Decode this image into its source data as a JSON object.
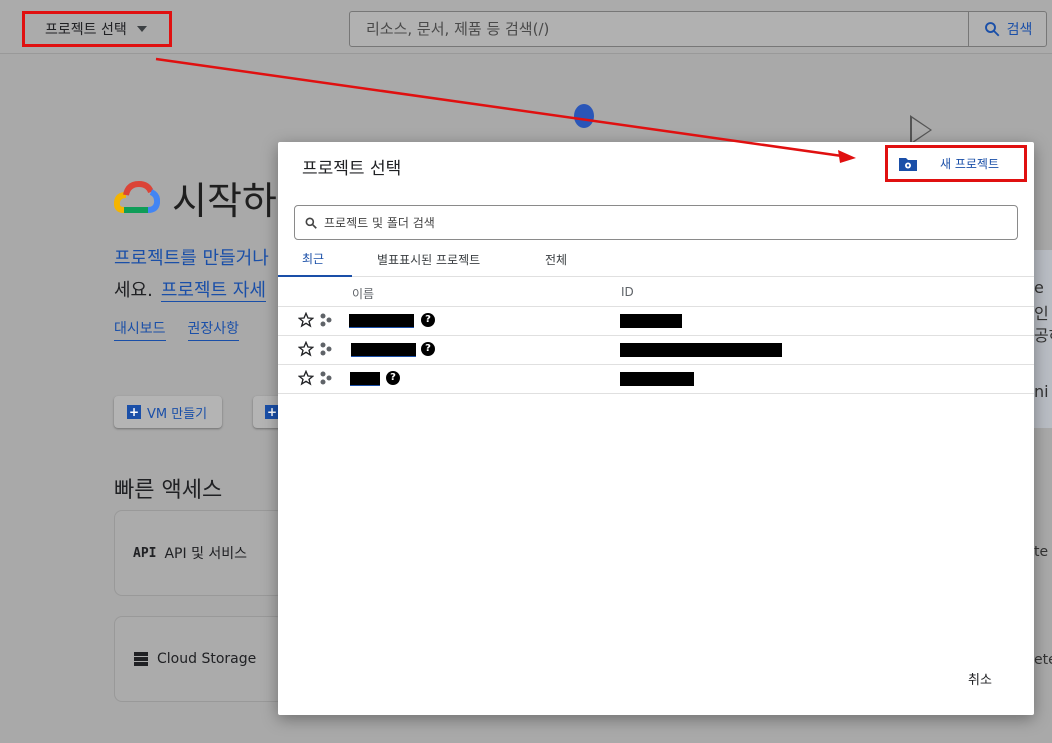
{
  "topbar": {
    "project_picker_label": "프로젝트 선택",
    "search_placeholder": "리소스, 문서, 제품 등 검색(/)",
    "search_button_label": "검색"
  },
  "background": {
    "title": "시작하",
    "intro_link": "프로젝트를 만들거나",
    "intro_text2": "세요.",
    "intro_link2": "프로젝트 자세",
    "links": [
      "대시보드",
      "권장사항"
    ],
    "vm_button_label": "VM 만들기",
    "quick_access_title": "빠른 액세스",
    "cards": [
      {
        "icon_label": "API",
        "label": "API 및 서비스"
      },
      {
        "label": "Cloud Storage"
      }
    ],
    "right_fragments": [
      "e",
      "인",
      "공하",
      "ni"
    ],
    "right_card_fragments": [
      "te",
      "ete"
    ]
  },
  "dialog": {
    "title": "프로젝트 선택",
    "new_project_label": "새 프로젝트",
    "search_placeholder": "프로젝트 및 폴더 검색",
    "tabs": [
      {
        "label": "최근",
        "active": true
      },
      {
        "label": "별표표시된 프로젝트",
        "active": false
      },
      {
        "label": "전체",
        "active": false
      }
    ],
    "columns": {
      "name": "이름",
      "id": "ID"
    },
    "rows": [
      {
        "name": "",
        "id": ""
      },
      {
        "name": "",
        "id": ""
      },
      {
        "name": "",
        "id": ""
      }
    ],
    "help_glyph": "?",
    "cancel_label": "취소"
  },
  "colors": {
    "accent_blue": "#1a4fa8",
    "highlight_red": "#e01010",
    "overlay_gray": "#a9a9a9"
  }
}
